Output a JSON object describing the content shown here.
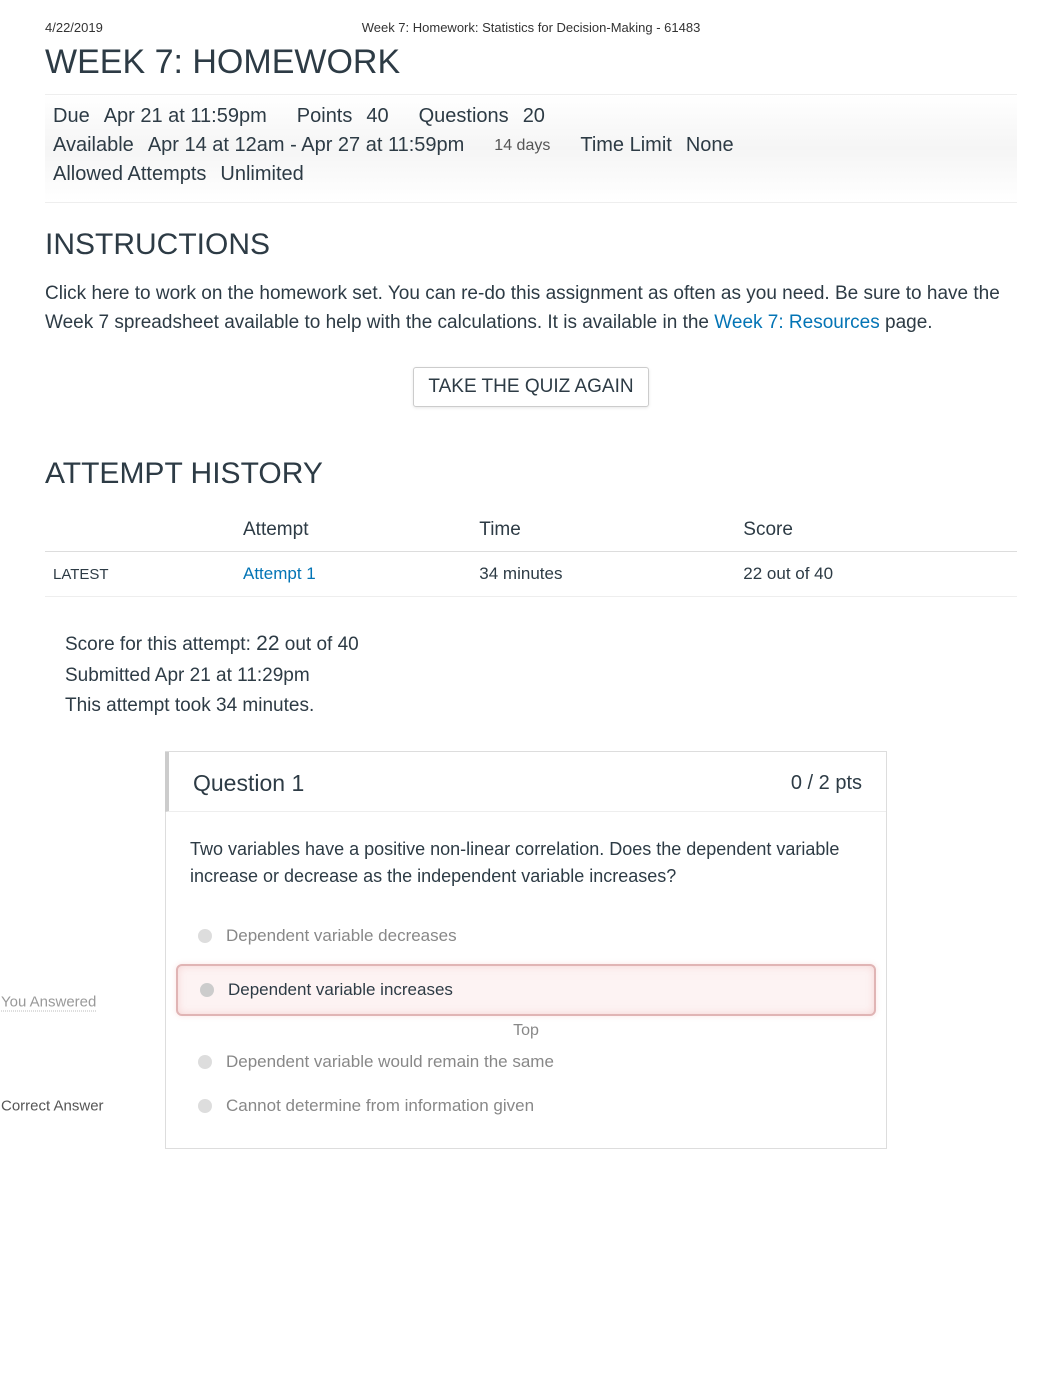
{
  "header": {
    "date": "4/22/2019",
    "doc_title": "Week 7: Homework: Statistics for Decision-Making - 61483"
  },
  "page_title": "WEEK 7: HOMEWORK",
  "meta": {
    "due_label": "Due",
    "due_value": "Apr 21 at 11:59pm",
    "points_label": "Points",
    "points_value": "40",
    "questions_label": "Questions",
    "questions_value": "20",
    "available_label": "Available",
    "available_value": "Apr 14 at 12am - Apr 27 at 11:59pm",
    "available_days": "14 days",
    "timelimit_label": "Time Limit",
    "timelimit_value": "None",
    "attempts_label": "Allowed Attempts",
    "attempts_value": "Unlimited"
  },
  "instructions": {
    "heading": "INSTRUCTIONS",
    "text_before": "Click here to work on the homework set. You can re-do this assignment as often as you need. Be sure to have the Week 7 spreadsheet available to help with the calculations. It is available in the ",
    "link_text": "Week 7: Resources",
    "text_after": " page."
  },
  "quiz_button": "TAKE THE QUIZ AGAIN",
  "history": {
    "heading": "ATTEMPT HISTORY",
    "cols": {
      "blank": "",
      "attempt": "Attempt",
      "time": "Time",
      "score": "Score"
    },
    "rows": [
      {
        "status": "LATEST",
        "attempt": "Attempt 1",
        "time": "34 minutes",
        "score": "22 out of 40"
      }
    ]
  },
  "score_block": {
    "prefix": "Score for this attempt: ",
    "score": "22",
    "suffix": " out of 40",
    "submitted": "Submitted Apr 21 at 11:29pm",
    "duration": "This attempt took 34 minutes."
  },
  "question": {
    "title": "Question 1",
    "pts": "0 / 2 pts",
    "body": "Two variables have a positive non-linear correlation. Does the dependent variable increase or decrease as the independent variable increases?",
    "answers": [
      {
        "text": "Dependent variable decreases",
        "label": ""
      },
      {
        "text": "Dependent variable increases",
        "label": "You Answered",
        "selected": true
      },
      {
        "text": "Dependent variable would remain the same",
        "label": ""
      },
      {
        "text": "Cannot determine from information given",
        "label": "Correct Answer"
      }
    ],
    "top_link": "Top"
  }
}
